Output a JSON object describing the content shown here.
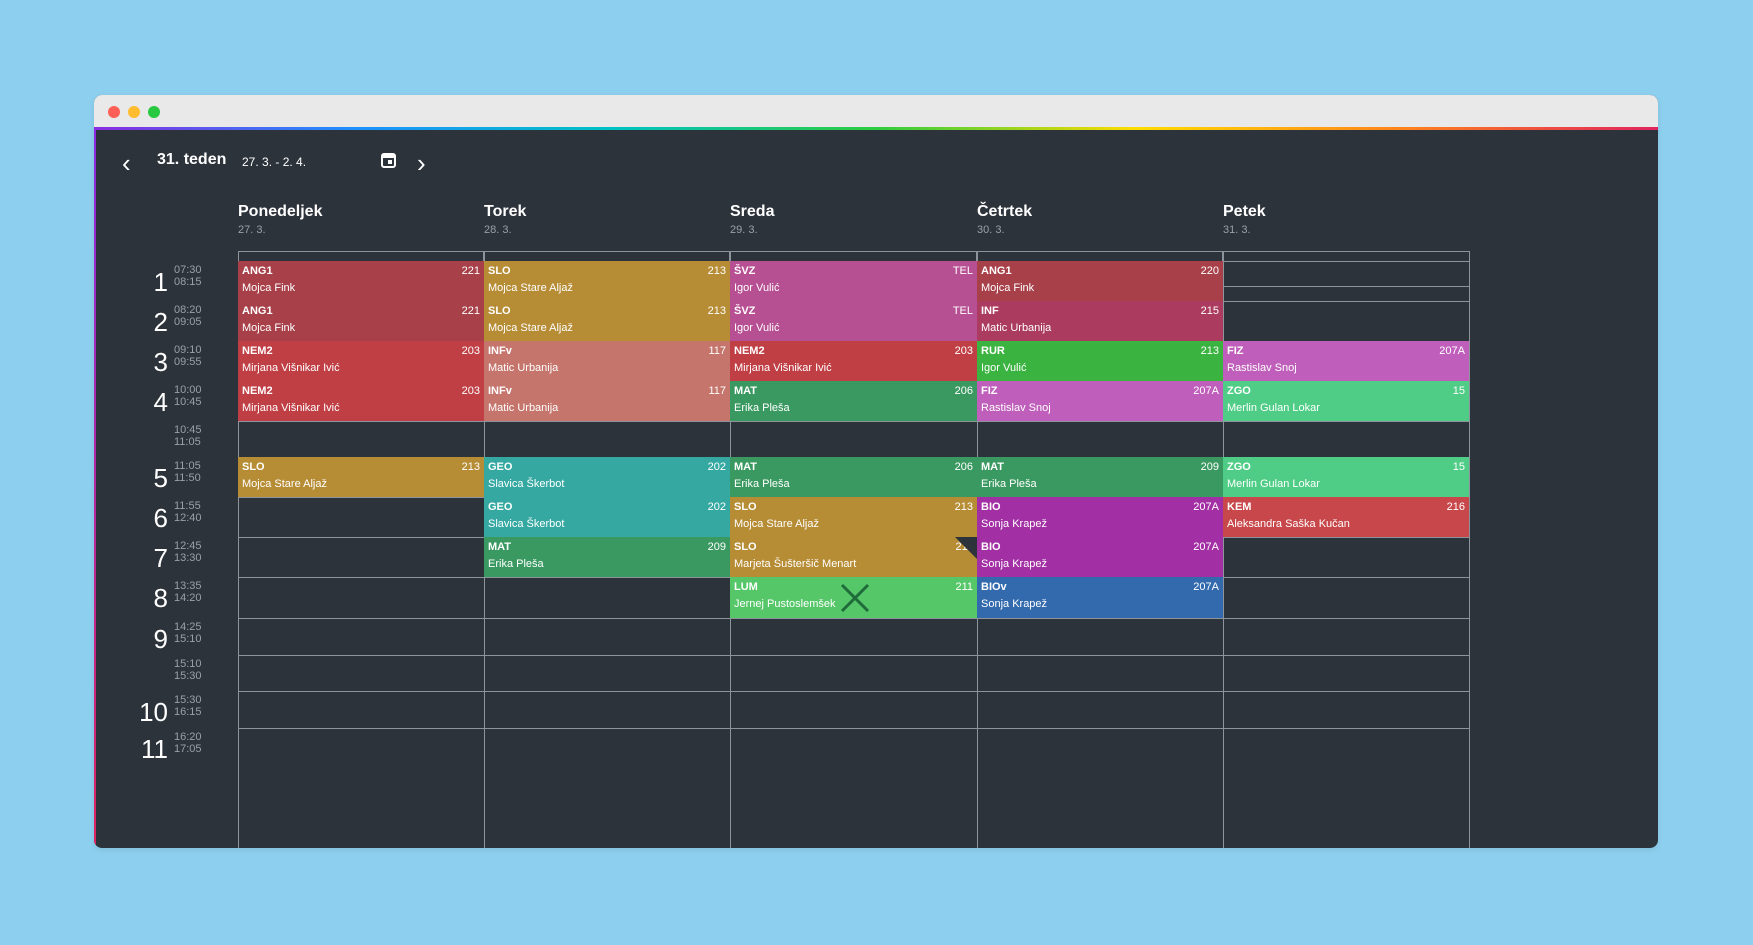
{
  "week": {
    "title": "31. teden",
    "range": "27. 3. - 2. 4.",
    "prev_icon": "‹",
    "next_icon": "›"
  },
  "days": [
    {
      "name": "Ponedeljek",
      "date": "27. 3."
    },
    {
      "name": "Torek",
      "date": "28. 3."
    },
    {
      "name": "Sreda",
      "date": "29. 3."
    },
    {
      "name": "Četrtek",
      "date": "30. 3."
    },
    {
      "name": "Petek",
      "date": "31. 3."
    }
  ],
  "periods": [
    {
      "num": "1",
      "start": "07:30",
      "end": "08:15"
    },
    {
      "num": "2",
      "start": "08:20",
      "end": "09:05"
    },
    {
      "num": "3",
      "start": "09:10",
      "end": "09:55"
    },
    {
      "num": "4",
      "start": "10:00",
      "end": "10:45"
    },
    {
      "num": "",
      "start": "10:45",
      "end": "11:05"
    },
    {
      "num": "5",
      "start": "11:05",
      "end": "11:50"
    },
    {
      "num": "6",
      "start": "11:55",
      "end": "12:40"
    },
    {
      "num": "7",
      "start": "12:45",
      "end": "13:30"
    },
    {
      "num": "8",
      "start": "13:35",
      "end": "14:20"
    },
    {
      "num": "9",
      "start": "14:25",
      "end": "15:10"
    },
    {
      "num": "",
      "start": "15:10",
      "end": "15:30"
    },
    {
      "num": "10",
      "start": "15:30",
      "end": "16:15"
    },
    {
      "num": "11",
      "start": "16:20",
      "end": "17:05"
    }
  ],
  "lessons": [
    {
      "day": 0,
      "row": 0,
      "subject": "ANG1",
      "room": "221",
      "teacher": "Mojca Fink",
      "color": "#a8404a"
    },
    {
      "day": 0,
      "row": 1,
      "subject": "ANG1",
      "room": "221",
      "teacher": "Mojca Fink",
      "color": "#a8404a"
    },
    {
      "day": 0,
      "row": 2,
      "subject": "NEM2",
      "room": "203",
      "teacher": "Mirjana Višnikar Ivić",
      "color": "#bf3f45"
    },
    {
      "day": 0,
      "row": 3,
      "subject": "NEM2",
      "room": "203",
      "teacher": "Mirjana Višnikar Ivić",
      "color": "#bf3f45"
    },
    {
      "day": 0,
      "row": 5,
      "subject": "SLO",
      "room": "213",
      "teacher": "Mojca Stare Aljaž",
      "color": "#b68c35"
    },
    {
      "day": 1,
      "row": 0,
      "subject": "SLO",
      "room": "213",
      "teacher": "Mojca Stare Aljaž",
      "color": "#b68c35"
    },
    {
      "day": 1,
      "row": 1,
      "subject": "SLO",
      "room": "213",
      "teacher": "Mojca Stare Aljaž",
      "color": "#b68c35"
    },
    {
      "day": 1,
      "row": 2,
      "subject": "INFv",
      "room": "117",
      "teacher": "Matic Urbanija",
      "color": "#c5756c"
    },
    {
      "day": 1,
      "row": 3,
      "subject": "INFv",
      "room": "117",
      "teacher": "Matic Urbanija",
      "color": "#c5756c"
    },
    {
      "day": 1,
      "row": 5,
      "subject": "GEO",
      "room": "202",
      "teacher": "Slavica Škerbot",
      "color": "#35a9a1"
    },
    {
      "day": 1,
      "row": 6,
      "subject": "GEO",
      "room": "202",
      "teacher": "Slavica Škerbot",
      "color": "#35a9a1"
    },
    {
      "day": 1,
      "row": 7,
      "subject": "MAT",
      "room": "209",
      "teacher": "Erika Pleša",
      "color": "#3a9961"
    },
    {
      "day": 2,
      "row": 0,
      "subject": "ŠVZ",
      "room": "TEL",
      "teacher": "Igor Vulić",
      "color": "#b74f93"
    },
    {
      "day": 2,
      "row": 1,
      "subject": "ŠVZ",
      "room": "TEL",
      "teacher": "Igor Vulić",
      "color": "#b74f93"
    },
    {
      "day": 2,
      "row": 2,
      "subject": "NEM2",
      "room": "203",
      "teacher": "Mirjana Višnikar Ivić",
      "color": "#bf3f45"
    },
    {
      "day": 2,
      "row": 3,
      "subject": "MAT",
      "room": "206",
      "teacher": "Erika Pleša",
      "color": "#3a9961"
    },
    {
      "day": 2,
      "row": 5,
      "subject": "MAT",
      "room": "206",
      "teacher": "Erika Pleša",
      "color": "#3a9961"
    },
    {
      "day": 2,
      "row": 6,
      "subject": "SLO",
      "room": "213",
      "teacher": "Mojca Stare Aljaž",
      "color": "#b68c35"
    },
    {
      "day": 2,
      "row": 7,
      "subject": "SLO",
      "room": "211",
      "teacher": "Marjeta Šušteršič Menart",
      "color": "#b68c35",
      "corner": true
    },
    {
      "day": 2,
      "row": 8,
      "subject": "LUM",
      "room": "211",
      "teacher": "Jernej Pustoslemšek",
      "color": "#55c769",
      "cancelled": true
    },
    {
      "day": 3,
      "row": 0,
      "subject": "ANG1",
      "room": "220",
      "teacher": "Mojca Fink",
      "color": "#a8404a"
    },
    {
      "day": 3,
      "row": 1,
      "subject": "INF",
      "room": "215",
      "teacher": "Matic Urbanija",
      "color": "#ac3b60"
    },
    {
      "day": 3,
      "row": 2,
      "subject": "RUR",
      "room": "213",
      "teacher": "Igor Vulić",
      "color": "#3bb340"
    },
    {
      "day": 3,
      "row": 3,
      "subject": "FIZ",
      "room": "207A",
      "teacher": "Rastislav Snoj",
      "color": "#bf5fbb"
    },
    {
      "day": 3,
      "row": 5,
      "subject": "MAT",
      "room": "209",
      "teacher": "Erika Pleša",
      "color": "#3a9961"
    },
    {
      "day": 3,
      "row": 6,
      "subject": "BIO",
      "room": "207A",
      "teacher": "Sonja Krapež",
      "color": "#a22fa3"
    },
    {
      "day": 3,
      "row": 7,
      "subject": "BIO",
      "room": "207A",
      "teacher": "Sonja Krapež",
      "color": "#a22fa3"
    },
    {
      "day": 3,
      "row": 8,
      "subject": "BIOv",
      "room": "207A",
      "teacher": "Sonja Krapež",
      "color": "#336aad"
    },
    {
      "day": 4,
      "row": 2,
      "subject": "FIZ",
      "room": "207A",
      "teacher": "Rastislav Snoj",
      "color": "#bf5fbb"
    },
    {
      "day": 4,
      "row": 3,
      "subject": "ZGO",
      "room": "15",
      "teacher": "Merlin Gulan Lokar",
      "color": "#4fcd86"
    },
    {
      "day": 4,
      "row": 5,
      "subject": "ZGO",
      "room": "15",
      "teacher": "Merlin Gulan Lokar",
      "color": "#4fcd86"
    },
    {
      "day": 4,
      "row": 6,
      "subject": "KEM",
      "room": "216",
      "teacher": "Aleksandra Saška Kučan",
      "color": "#c8474a"
    }
  ]
}
